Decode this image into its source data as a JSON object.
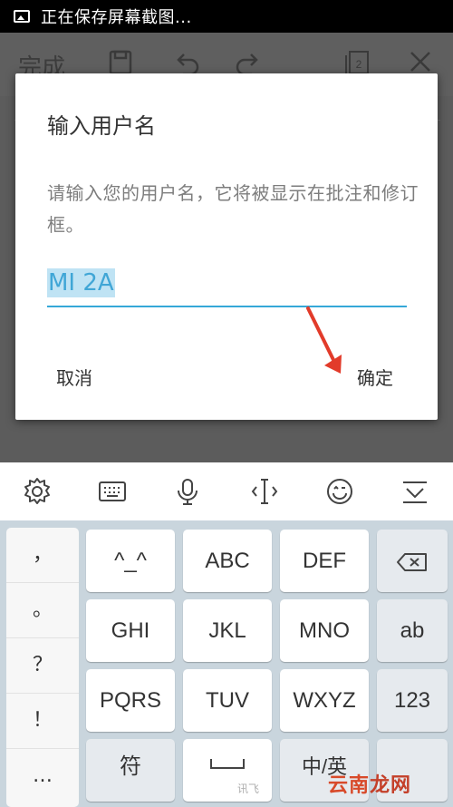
{
  "status_bar": {
    "text": "正在保存屏幕截图..."
  },
  "app_bar": {
    "done_label": "完成",
    "page_count": "2"
  },
  "dialog": {
    "title": "输入用户名",
    "message": "请输入您的用户名，它将被显示在批注和修订框。",
    "input_value": "MI 2A",
    "cancel_label": "取消",
    "ok_label": "确定"
  },
  "keyboard": {
    "punctuation": [
      "，",
      "。",
      "？",
      "！",
      "…"
    ],
    "keys": {
      "emoticon": "^_^",
      "abc": "ABC",
      "def": "DEF",
      "ghi": "GHI",
      "jkl": "JKL",
      "mno": "MNO",
      "ab": "ab",
      "pqrs": "PQRS",
      "tuv": "TUV",
      "wxyz": "WXYZ",
      "num": "123",
      "symbol": "符",
      "lang": "中/英"
    },
    "space_hint": "讯飞"
  },
  "watermark": {
    "text1": "云南",
    "text2": "龙网"
  },
  "colors": {
    "accent": "#35a8d8",
    "selection": "#bfe3f4"
  }
}
